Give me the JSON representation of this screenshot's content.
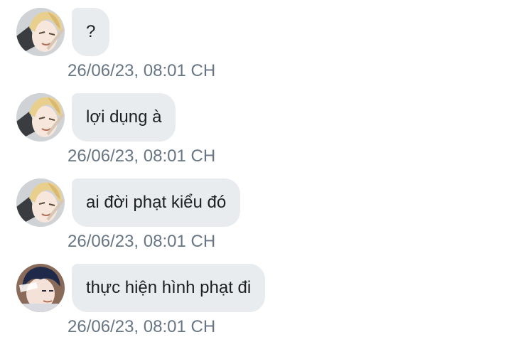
{
  "messages": [
    {
      "text": "?",
      "time": "26/06/23, 08:01 CH",
      "avatar": "blonde-avatar-icon"
    },
    {
      "text": "lợi dụng à",
      "time": "26/06/23, 08:01 CH",
      "avatar": "blonde-avatar-icon"
    },
    {
      "text": "ai đời phạt kiểu đó",
      "time": "26/06/23, 08:01 CH",
      "avatar": "blonde-avatar-icon"
    },
    {
      "text": "thực hiện hình phạt đi",
      "time": "26/06/23, 08:01 CH",
      "avatar": "darkhair-avatar-icon"
    }
  ],
  "colors": {
    "bubble": "#e9ecef",
    "text": "#1c1f23",
    "timestamp": "#687684",
    "background": "#ffffff"
  }
}
